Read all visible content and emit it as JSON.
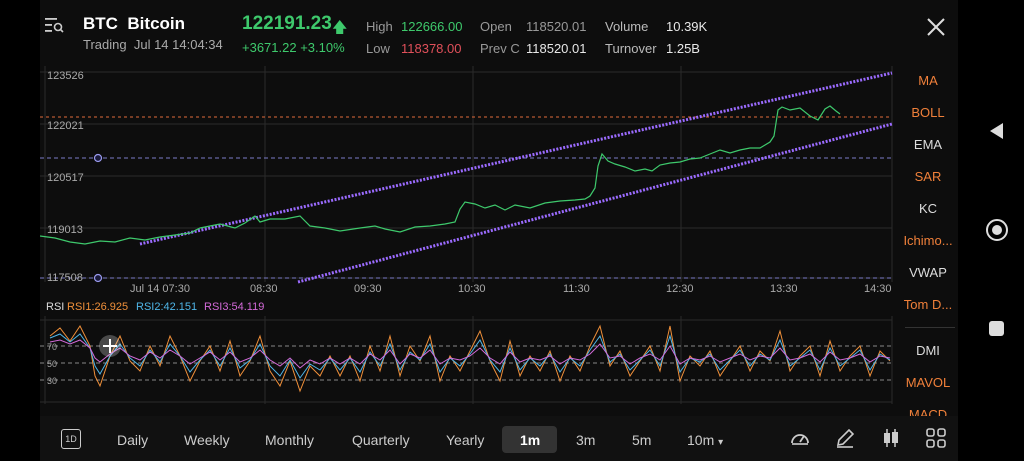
{
  "header": {
    "symbol": "BTC",
    "name": "Bitcoin",
    "status": "Trading",
    "timestamp": "Jul 14 14:04:34",
    "price": "122191.23",
    "change": "+3671.22",
    "change_pct": "+3.10%"
  },
  "stats": {
    "high_label": "High",
    "high": "122666.00",
    "low_label": "Low",
    "low": "118378.00",
    "open_label": "Open",
    "open": "118520.01",
    "prev_label": "Prev C",
    "prev": "118520.01",
    "volume_label": "Volume",
    "volume": "10.39K",
    "turnover_label": "Turnover",
    "turnover": "1.25B"
  },
  "chart": {
    "y_ticks": [
      "123526",
      "122021",
      "120517",
      "119013",
      "117508"
    ],
    "x_ticks": [
      "Jul 14 07:30",
      "08:30",
      "09:30",
      "10:30",
      "11:30",
      "12:30",
      "13:30",
      "14:30"
    ],
    "rsi_ticks": [
      "70",
      "50",
      "30"
    ],
    "rsi_legend": {
      "label": "RSI",
      "rsi1": "RSI1:26.925",
      "rsi2": "RSI2:42.151",
      "rsi3": "RSI3:54.119"
    },
    "colors": {
      "price_line": "#3ec96c",
      "channel": "#9b6bff",
      "rsi1": "#f0903a",
      "rsi2": "#4fb6e8",
      "rsi3": "#d36ad8",
      "current_price_line": "#e06a3a",
      "alert_line": "#7c7cc8"
    }
  },
  "indicators": {
    "main": [
      {
        "label": "MA",
        "active": true
      },
      {
        "label": "BOLL",
        "active": true
      },
      {
        "label": "EMA",
        "active": false
      },
      {
        "label": "SAR",
        "active": true
      },
      {
        "label": "KC",
        "active": false
      },
      {
        "label": "Ichimo...",
        "active": true
      },
      {
        "label": "VWAP",
        "active": false
      },
      {
        "label": "Tom D...",
        "active": true
      }
    ],
    "sub": [
      {
        "label": "DMI",
        "active": false
      },
      {
        "label": "MAVOL",
        "active": true
      },
      {
        "label": "MACD",
        "active": true
      }
    ]
  },
  "timeframes": {
    "period_badge": "1D",
    "items": [
      "Daily",
      "Weekly",
      "Monthly",
      "Quarterly",
      "Yearly",
      "1m",
      "3m",
      "5m",
      "10m"
    ],
    "selected": "1m",
    "dropdown_suffix": "▾"
  },
  "icons": [
    "search-list-icon",
    "close-icon",
    "gauge-icon",
    "draw-pen-icon",
    "candlestick-icon",
    "grid-icon",
    "nav-back-icon",
    "nav-home-icon",
    "nav-recent-icon"
  ]
}
